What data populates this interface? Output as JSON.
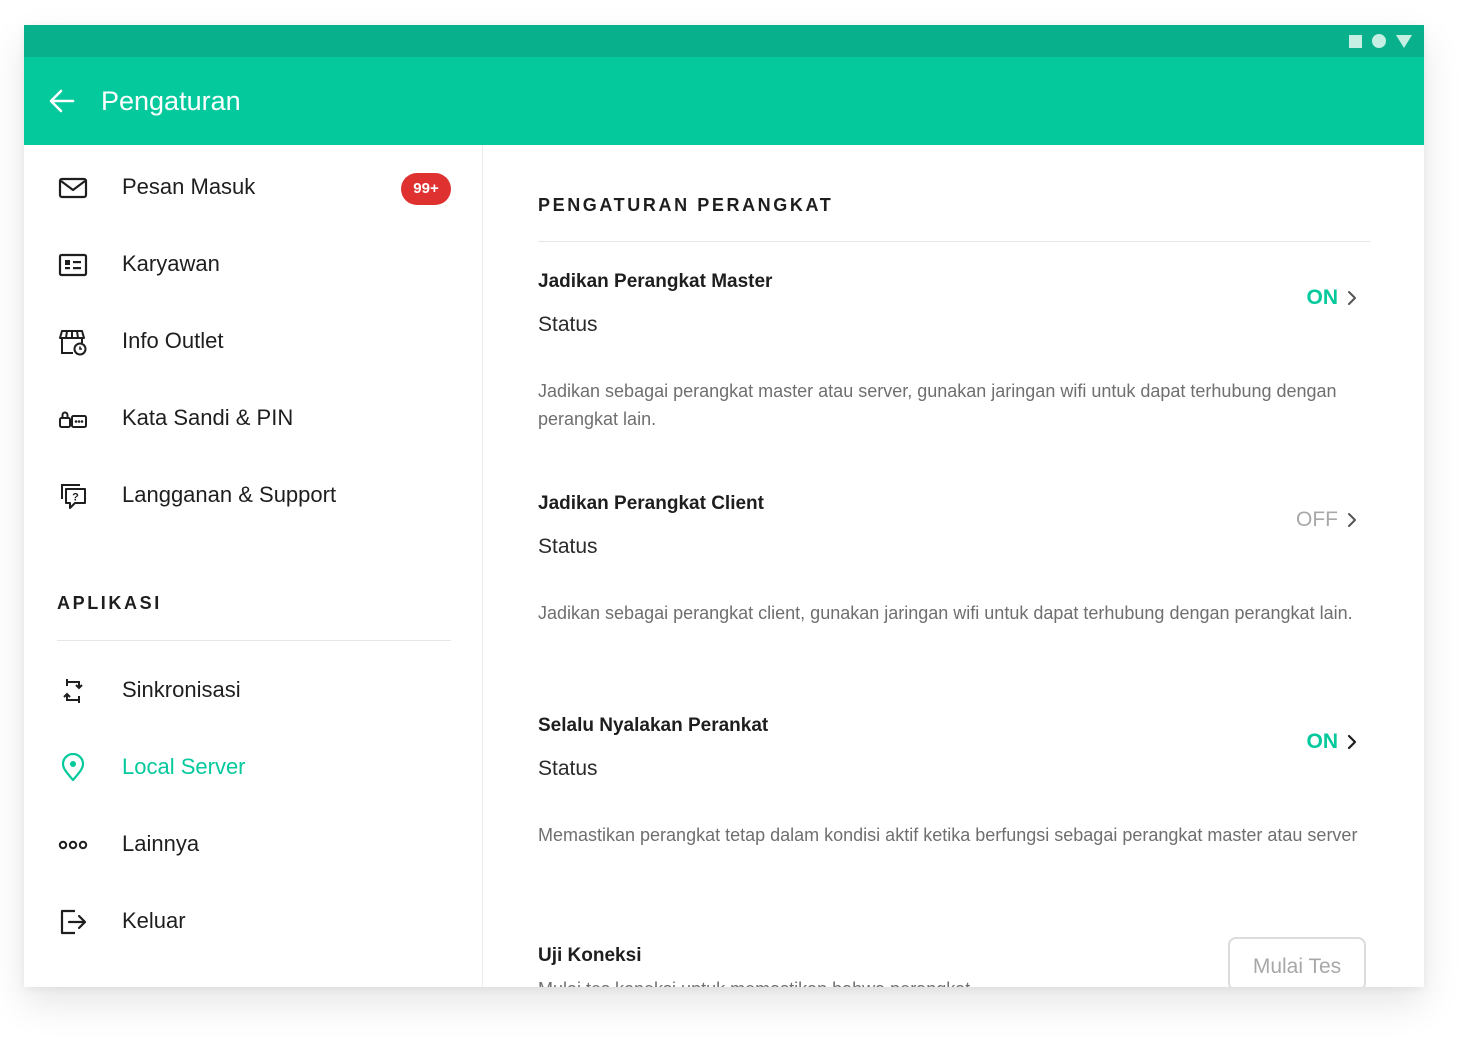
{
  "header": {
    "title": "Pengaturan"
  },
  "sidebar": {
    "items": [
      {
        "label": "Pesan Masuk",
        "icon": "mail-icon",
        "badge": "99+"
      },
      {
        "label": "Karyawan",
        "icon": "id-card-icon"
      },
      {
        "label": "Info Outlet",
        "icon": "store-icon"
      },
      {
        "label": "Kata Sandi & PIN",
        "icon": "password-icon"
      },
      {
        "label": "Langganan & Support",
        "icon": "support-icon"
      }
    ],
    "section_title": "APLIKASI",
    "app_items": [
      {
        "label": "Sinkronisasi",
        "icon": "sync-icon"
      },
      {
        "label": "Local Server",
        "icon": "location-pin-icon",
        "active": true
      },
      {
        "label": "Lainnya",
        "icon": "more-icon"
      },
      {
        "label": "Keluar",
        "icon": "logout-icon"
      }
    ]
  },
  "content": {
    "section_title": "PENGATURAN PERANGKAT",
    "settings": [
      {
        "title": "Jadikan Perangkat Master",
        "subtitle": "Status",
        "state": "ON",
        "description": "Jadikan sebagai perangkat master atau server, gunakan jaringan wifi untuk dapat terhubung dengan perangkat lain."
      },
      {
        "title": "Jadikan Perangkat Client",
        "subtitle": "Status",
        "state": "OFF",
        "description": "Jadikan sebagai perangkat client, gunakan jaringan wifi untuk dapat terhubung dengan perangkat lain."
      },
      {
        "title": "Selalu Nyalakan Perankat",
        "subtitle": "Status",
        "state": "ON",
        "description": "Memastikan perangkat tetap dalam kondisi aktif ketika berfungsi sebagai perangkat master atau server"
      }
    ],
    "test": {
      "title": "Uji Koneksi",
      "description": "Mulai tes koneksi untuk memastikan bahwa perangkat",
      "button_label": "Mulai Tes"
    }
  },
  "colors": {
    "accent": "#04c99c",
    "statusbar": "#09b08c",
    "badge": "#e03131",
    "off": "#a8a8a8"
  }
}
